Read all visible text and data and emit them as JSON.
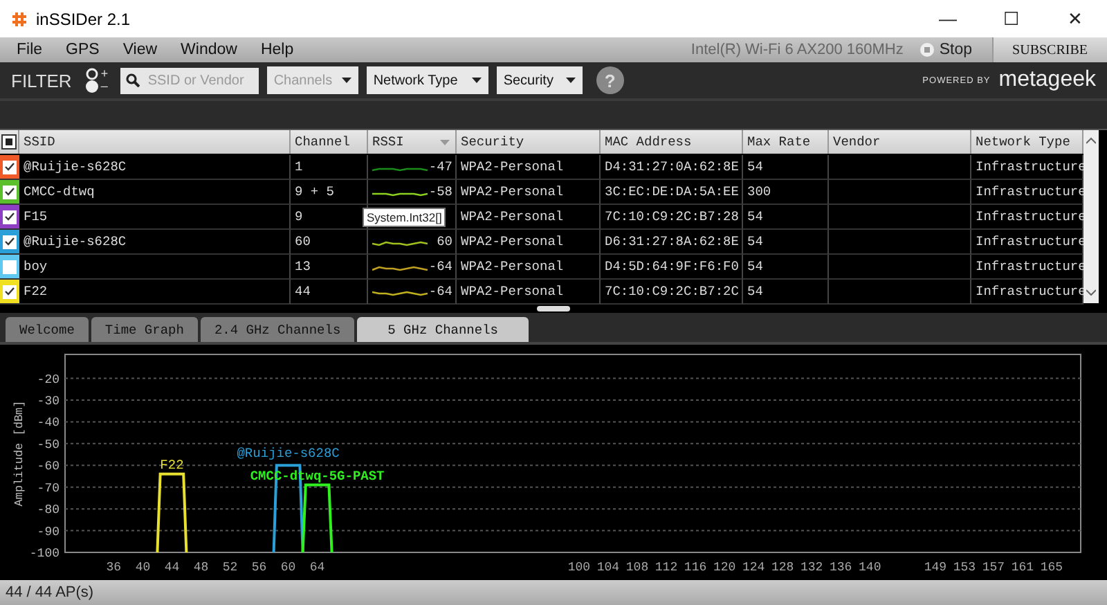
{
  "window": {
    "title": "inSSIDer 2.1",
    "controls": [
      "—",
      "☐",
      "✕"
    ]
  },
  "menu": [
    "File",
    "GPS",
    "View",
    "Window",
    "Help"
  ],
  "adapter": "Intel(R) Wi-Fi 6 AX200 160MHz",
  "stop_button": "Stop",
  "subscribe_button": "SUBSCRIBE",
  "filter": {
    "label": "FILTER",
    "plus": "+",
    "minus": "–",
    "search": {
      "placeholder": "SSID or Vendor"
    },
    "dropdowns": [
      {
        "label": "Channels",
        "disabled": true
      },
      {
        "label": "Network Type",
        "disabled": false
      },
      {
        "label": "Security",
        "disabled": false
      }
    ],
    "help": "?",
    "powered_by": "POWERED BY",
    "brand": "metageek"
  },
  "table": {
    "columns": [
      "SSID",
      "Channel",
      "RSSI",
      "Security",
      "MAC Address",
      "Max Rate",
      "Vendor",
      "Network Type"
    ],
    "rows": [
      {
        "color": "#f05a28",
        "checked": true,
        "ssid": "@Ruijie-s628C",
        "channel": "1",
        "rssi": "-47",
        "security": "WPA2-Personal",
        "mac": "D4:31:27:0A:62:8E",
        "rate": "54",
        "type": "Infrastructure"
      },
      {
        "color": "#5cc02c",
        "checked": true,
        "ssid": "CMCC-dtwq",
        "channel": "9 + 5",
        "rssi": "-58",
        "security": "WPA2-Personal",
        "mac": "3C:EC:DE:DA:5A:EE",
        "rate": "300",
        "type": "Infrastructure"
      },
      {
        "color": "#8e3fc4",
        "checked": true,
        "ssid": "F15",
        "channel": "9",
        "security": "WPA2-Personal",
        "mac": "7C:10:C9:2C:B7:28",
        "rate": "54",
        "type": "Infrastructure"
      },
      {
        "color": "#2a9fd8",
        "checked": true,
        "ssid": "@Ruijie-s628C",
        "channel": "60",
        "rssi": "60",
        "security": "WPA2-Personal",
        "mac": "D6:31:27:8A:62:8E",
        "rate": "54",
        "type": "Infrastructure"
      },
      {
        "color": "#5ec8f0",
        "checked": false,
        "ssid": "boy",
        "channel": "13",
        "rssi": "-64",
        "security": "WPA2-Personal",
        "mac": "D4:5D:64:9F:F6:F0",
        "rate": "54",
        "type": "Infrastructure"
      },
      {
        "color": "#f0e020",
        "checked": true,
        "ssid": "F22",
        "channel": "44",
        "rssi": "-64",
        "security": "WPA2-Personal",
        "mac": "7C:10:C9:2C:B7:2C",
        "rate": "54",
        "type": "Infrastructure"
      }
    ],
    "tooltip": "System.Int32[]",
    "select_all": {
      "indeterminate": true
    }
  },
  "tabs": [
    {
      "label": "Welcome",
      "selected": false
    },
    {
      "label": "Time Graph",
      "selected": false
    },
    {
      "label": "2.4 GHz Channels",
      "selected": false
    },
    {
      "label": "5 GHz Channels",
      "selected": true
    }
  ],
  "chart": {
    "chart_data": {
      "type": "line",
      "ylabel": "Amplitude [dBm]",
      "x": [
        42,
        42.4,
        45.6,
        46,
        58,
        58.4,
        61.6,
        62,
        62.4,
        65.6,
        66
      ],
      "series": [
        {
          "name": "F22",
          "color": "#e8e030",
          "values": [
            -100,
            -64,
            -64,
            -100,
            null,
            null,
            null,
            null,
            null,
            null,
            null
          ]
        },
        {
          "name": "@Ruijie-s628C",
          "color": "#2a9fd8",
          "values": [
            null,
            null,
            null,
            null,
            -100,
            -60,
            -60,
            -100,
            null,
            null,
            null
          ]
        },
        {
          "name": "CMCC-dtwq-5G-PAST",
          "color": "#30f020",
          "values": [
            null,
            null,
            null,
            null,
            null,
            null,
            null,
            -100,
            -69,
            -69,
            -100
          ]
        }
      ],
      "grid": true,
      "xlim": [
        29.3,
        169
      ],
      "ylim": [
        -100,
        -9
      ],
      "xticks": [
        36,
        40,
        44,
        48,
        52,
        56,
        60,
        64,
        100,
        104,
        108,
        112,
        116,
        120,
        124,
        128,
        132,
        136,
        140,
        149,
        153,
        157,
        161,
        165
      ],
      "yticks": [
        -20,
        -30,
        -40,
        -50,
        -60,
        -70,
        -80,
        -90,
        -100
      ]
    }
  },
  "status_bar": "44 / 44 AP(s)"
}
